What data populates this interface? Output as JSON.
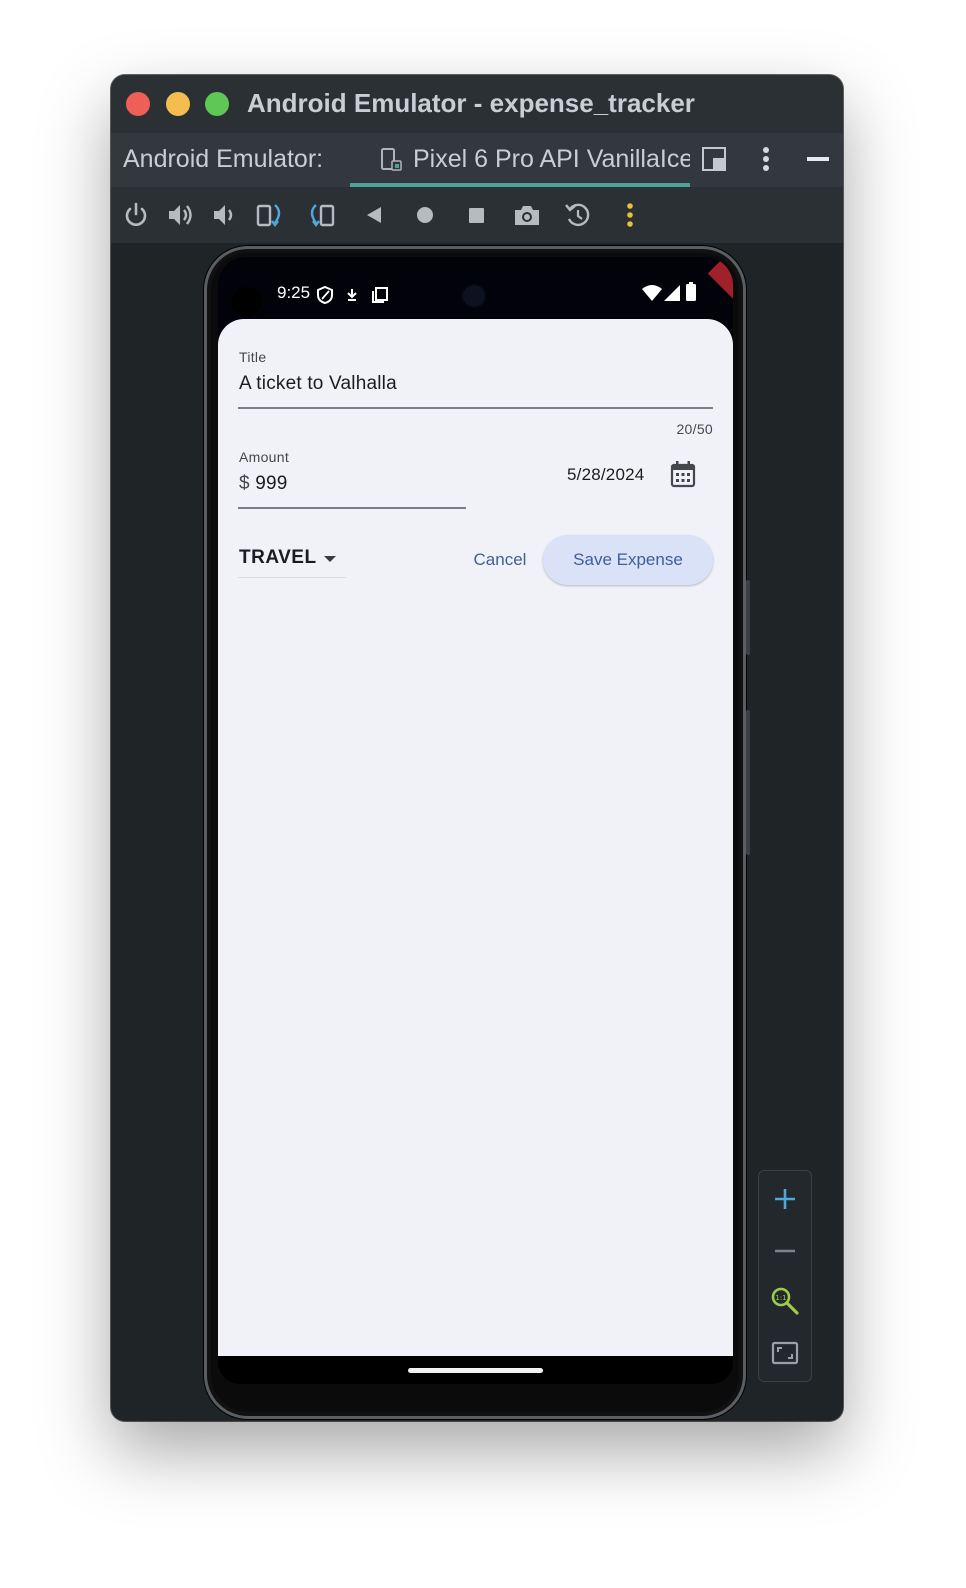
{
  "window": {
    "title": "Android Emulator - expense_tracker"
  },
  "tabbar": {
    "prefix": "Android Emulator:",
    "device_tab": "Pixel 6 Pro API VanillaIce"
  },
  "toolbar": {
    "buttons": [
      "power-icon",
      "volume-up-icon",
      "volume-down-icon",
      "rotate-left-icon",
      "rotate-right-icon",
      "back-icon",
      "home-icon",
      "overview-icon",
      "camera-icon",
      "snapshot-icon",
      "more-icon"
    ]
  },
  "status_bar": {
    "time": "9:25"
  },
  "debug_banner": "DEBUG",
  "form": {
    "title_label": "Title",
    "title_value": "A ticket to Valhalla",
    "title_counter": "20/50",
    "amount_label": "Amount",
    "amount_prefix": "$",
    "amount_value": "999",
    "date_value": "5/28/2024",
    "category_value": "TRAVEL",
    "cancel_label": "Cancel",
    "save_label": "Save Expense"
  },
  "colors": {
    "accent_teal": "#4da39a",
    "primary_text": "#3f5f9a",
    "save_button_bg": "#d9e2f6",
    "app_bg": "#f1f2f8"
  }
}
